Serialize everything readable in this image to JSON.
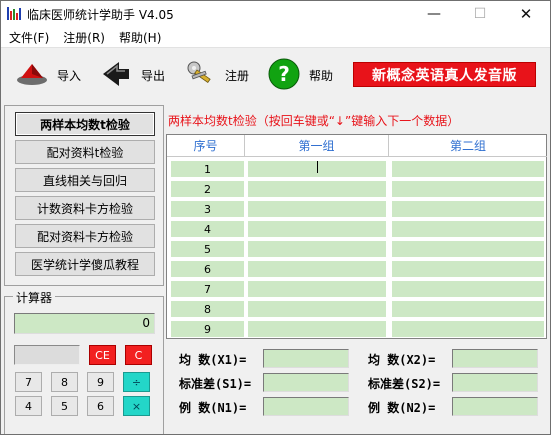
{
  "window": {
    "title": "临床医师统计学助手 V4.05",
    "controls": {
      "minimize": "—",
      "maximize": "☐",
      "close": "✕"
    }
  },
  "menu": [
    "文件(F)",
    "注册(R)",
    "帮助(H)"
  ],
  "toolbar": {
    "import_label": "导入",
    "export_label": "导出",
    "register_label": "注册",
    "help_label": "帮助",
    "promo_label": "新概念英语真人发音版"
  },
  "nav": {
    "items": [
      "两样本均数t检验",
      "配对资料t检验",
      "直线相关与回归",
      "计数资料卡方检验",
      "配对资料卡方检验",
      "医学统计学傻瓜教程"
    ],
    "active_index": 0
  },
  "calculator": {
    "title": "计算器",
    "display": "0",
    "keys": {
      "ce": "CE",
      "c": "C",
      "k7": "7",
      "k8": "8",
      "k9": "9",
      "div": "÷",
      "k4": "4",
      "k5": "5",
      "k6": "6",
      "mul": "×"
    }
  },
  "main": {
    "header": "两样本均数t检验（按回车键或“↓”键输入下一个数据）",
    "columns": [
      "序号",
      "第一组",
      "第二组"
    ],
    "rows": [
      "1",
      "2",
      "3",
      "4",
      "5",
      "6",
      "7",
      "8",
      "9"
    ]
  },
  "stats": {
    "mean1": "均  数(X1)=",
    "mean2": "均  数(X2)=",
    "sd1": "标准差(S1)=",
    "sd2": "标准差(S2)=",
    "n1": "例  数(N1)=",
    "n2": "例  数(N2)="
  },
  "colors": {
    "accent_red": "#e8131a",
    "input_green": "#cde8c5",
    "header_blue": "#2f6fd0",
    "calc_teal": "#23d6c8"
  }
}
